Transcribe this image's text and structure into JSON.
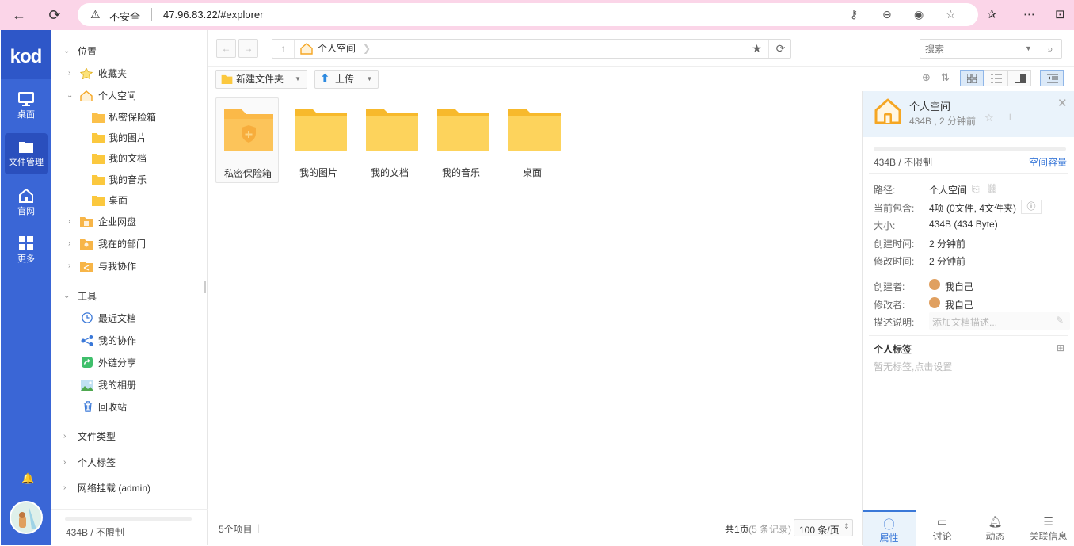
{
  "browser": {
    "insecure_label": "不安全",
    "url": "47.96.83.22/#explorer"
  },
  "kod": {
    "logo": "kod",
    "nav": [
      {
        "label": "桌面",
        "icon": "monitor-icon"
      },
      {
        "label": "文件管理",
        "icon": "folder-icon"
      },
      {
        "label": "官网",
        "icon": "home-icon"
      },
      {
        "label": "更多",
        "icon": "grid-icon"
      }
    ]
  },
  "tree": {
    "location_header": "位置",
    "favorites": "收藏夹",
    "personal_space": "个人空间",
    "children": [
      "私密保险箱",
      "我的图片",
      "我的文档",
      "我的音乐",
      "桌面"
    ],
    "enterprise": "企业网盘",
    "department": "我在的部门",
    "collab": "与我协作",
    "tools_header": "工具",
    "tools": [
      "最近文档",
      "我的协作",
      "外链分享",
      "我的相册",
      "回收站"
    ],
    "file_types": "文件类型",
    "personal_tags": "个人标签",
    "network_mount": "网络挂载 (admin)",
    "footer_quota": "434B / 不限制"
  },
  "toolbar": {
    "breadcrumb": "个人空间",
    "search_placeholder": "搜索",
    "new_folder": "新建文件夹",
    "upload": "上传"
  },
  "files": [
    {
      "name": "私密保险箱",
      "type": "safe"
    },
    {
      "name": "我的图片",
      "type": "folder"
    },
    {
      "name": "我的文档",
      "type": "folder"
    },
    {
      "name": "我的音乐",
      "type": "folder"
    },
    {
      "name": "桌面",
      "type": "folder"
    }
  ],
  "status": {
    "count": "5个项目",
    "pages": "共1页",
    "records": "(5 条记录)",
    "per_page": "100 条/页"
  },
  "panel": {
    "title": "个人空间",
    "subtitle": "434B , 2 分钟前",
    "quota": "434B / 不限制",
    "quota_link": "空间容量",
    "path_label": "路径:",
    "path_value": "个人空间",
    "contains_label": "当前包含:",
    "contains_value": "4项 (0文件, 4文件夹)",
    "size_label": "大小:",
    "size_value": "434B (434 Byte)",
    "created_label": "创建时间:",
    "created_value": "2 分钟前",
    "modified_label": "修改时间:",
    "modified_value": "2 分钟前",
    "creator_label": "创建者:",
    "creator_value": "我自己",
    "modifier_label": "修改者:",
    "modifier_value": "我自己",
    "desc_label": "描述说明:",
    "desc_placeholder": "添加文档描述...",
    "tags_header": "个人标签",
    "tags_empty": "暂无标签,点击设置",
    "tabs": [
      "属性",
      "讨论",
      "动态",
      "关联信息"
    ]
  },
  "colors": {
    "accent": "#3a66d6",
    "folder": "#fbc83e",
    "chrome": "#fbd5e8"
  }
}
